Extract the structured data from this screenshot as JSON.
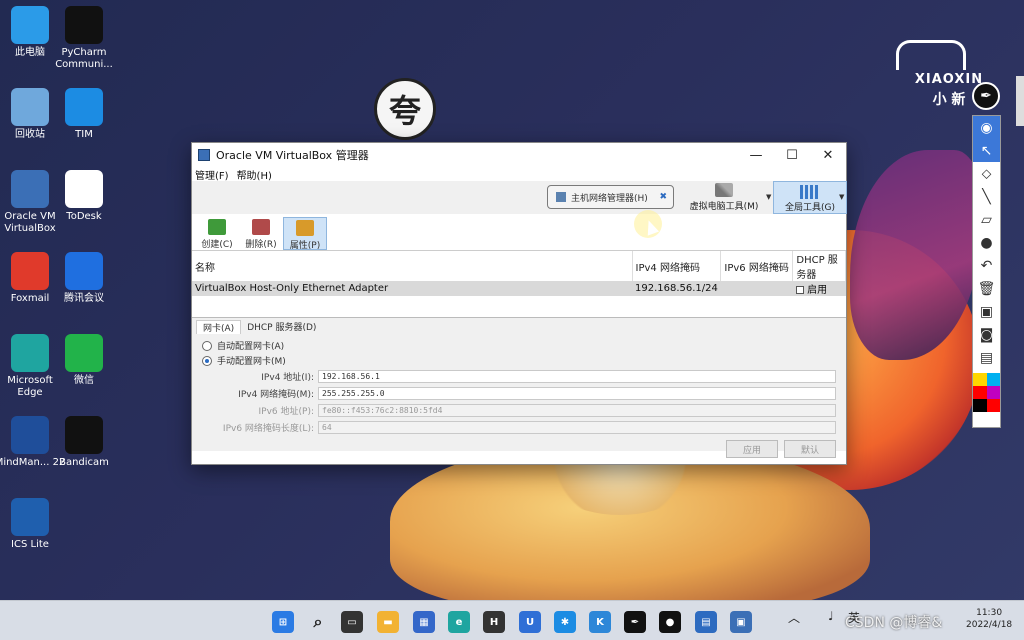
{
  "desktop": {
    "icons": [
      {
        "label": "此电脑",
        "icon": "computer-icon",
        "color": "#2b9be8"
      },
      {
        "label": "PyCharm Communi...",
        "icon": "pycharm-icon",
        "color": "#111111"
      },
      {
        "label": "回收站",
        "icon": "recycle-bin-icon",
        "color": "#6fa8dc"
      },
      {
        "label": "TIM",
        "icon": "tim-icon",
        "color": "#1c8ce3"
      },
      {
        "label": "Oracle VM VirtualBox",
        "icon": "virtualbox-icon",
        "color": "#3b6fb6"
      },
      {
        "label": "ToDesk",
        "icon": "todesk-icon",
        "color": "#ffffff"
      },
      {
        "label": "Foxmail",
        "icon": "foxmail-icon",
        "color": "#e03a2b"
      },
      {
        "label": "腾讯会议",
        "icon": "tencent-meeting-icon",
        "color": "#1f6fe0"
      },
      {
        "label": "Microsoft Edge",
        "icon": "edge-icon",
        "color": "#1fa5a0"
      },
      {
        "label": "微信",
        "icon": "wechat-icon",
        "color": "#22b34a"
      },
      {
        "label": "MindMan... 22",
        "icon": "mindmanager-icon",
        "color": "#1f4e9a"
      },
      {
        "label": "Bandicam",
        "icon": "bandicam-icon",
        "color": "#111111"
      },
      {
        "label": "ICS Lite",
        "icon": "ics-lite-icon",
        "color": "#1f5fae"
      }
    ]
  },
  "logo": {
    "name": "XIAOXIN",
    "cn": "小  新"
  },
  "window": {
    "title": "Oracle VM VirtualBox 管理器",
    "menu": [
      "管理(F)",
      "帮助(H)"
    ],
    "tools": {
      "host_network": "主机网络管理器(H)",
      "vm_tools": "虚拟电脑工具(M)",
      "global_tools": "全局工具(G)"
    },
    "actions": [
      "创建(C)",
      "删除(R)",
      "属性(P)"
    ],
    "table": {
      "headers": [
        "名称",
        "IPv4 网络掩码",
        "IPv6 网络掩码",
        "DHCP 服务器"
      ],
      "rows": [
        {
          "name": "VirtualBox Host-Only Ethernet Adapter",
          "ipv4": "192.168.56.1/24",
          "ipv6": "",
          "dhcp": "启用"
        }
      ]
    },
    "tabs": [
      "网卡(A)",
      "DHCP 服务器(D)"
    ],
    "radios": [
      "自动配置网卡(A)",
      "手动配置网卡(M)"
    ],
    "fields": [
      {
        "label": "IPv4 地址(I):",
        "value": "192.168.56.1"
      },
      {
        "label": "IPv4 网络掩码(M):",
        "value": "255.255.255.0"
      },
      {
        "label": "IPv6 地址(P):",
        "value": "fe80::f453:76c2:8810:5fd4"
      },
      {
        "label": "IPv6 网络掩码长度(L):",
        "value": "64"
      }
    ],
    "buttons": [
      "应用",
      "默认"
    ]
  },
  "taskbar": {
    "tray_lang": "英",
    "time": "11:30",
    "date": "2022/4/18"
  },
  "watermark": "CSDN @博睿&"
}
